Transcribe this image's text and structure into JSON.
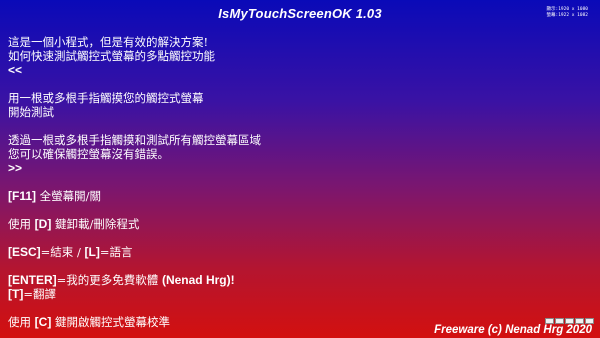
{
  "app": {
    "title": "IsMyTouchScreenOK 1.03"
  },
  "resolution": {
    "line1": "顯示:1920 x 1080",
    "line2": "螢幕:1922 x 1082"
  },
  "content": {
    "intro1": "這是一個小程式，但是有效的解決方案!",
    "intro2": "如何快速測試觸控式螢幕的多點觸控功能",
    "back": "<<",
    "step1a": "用一根或多根手指觸摸您的觸控式螢幕",
    "step1b": "開始測試",
    "step2a": "透過一根或多根手指觸摸和測試所有觸控螢幕區域",
    "step2b": "您可以確保觸控螢幕沒有錯誤。",
    "next": ">>",
    "f11_key": "[F11]",
    "f11_text": " 全螢幕開/關",
    "d_pre": "使用 ",
    "d_key": "[D]",
    "d_text": " 鍵卸載/刪除程式",
    "esc_key": "[ESC]",
    "esc_text": "=結束 / ",
    "l_key": "[L]",
    "l_text": "=語言",
    "enter_key": "[ENTER]",
    "enter_text1": "=我的更多免費軟體 ",
    "enter_text2": "(Nenad Hrg)!",
    "t_key": "[T]",
    "t_text": "=翻譯",
    "c_pre": "使用 ",
    "c_key": "[C]",
    "c_text": " 鍵開啟觸控式螢幕校準"
  },
  "footer": {
    "text": "Freeware (c) Nenad Hrg 2020"
  },
  "colors": {
    "gradient_top": "#0a0ab8",
    "gradient_bottom": "#d3100f",
    "text": "#ffffff"
  }
}
